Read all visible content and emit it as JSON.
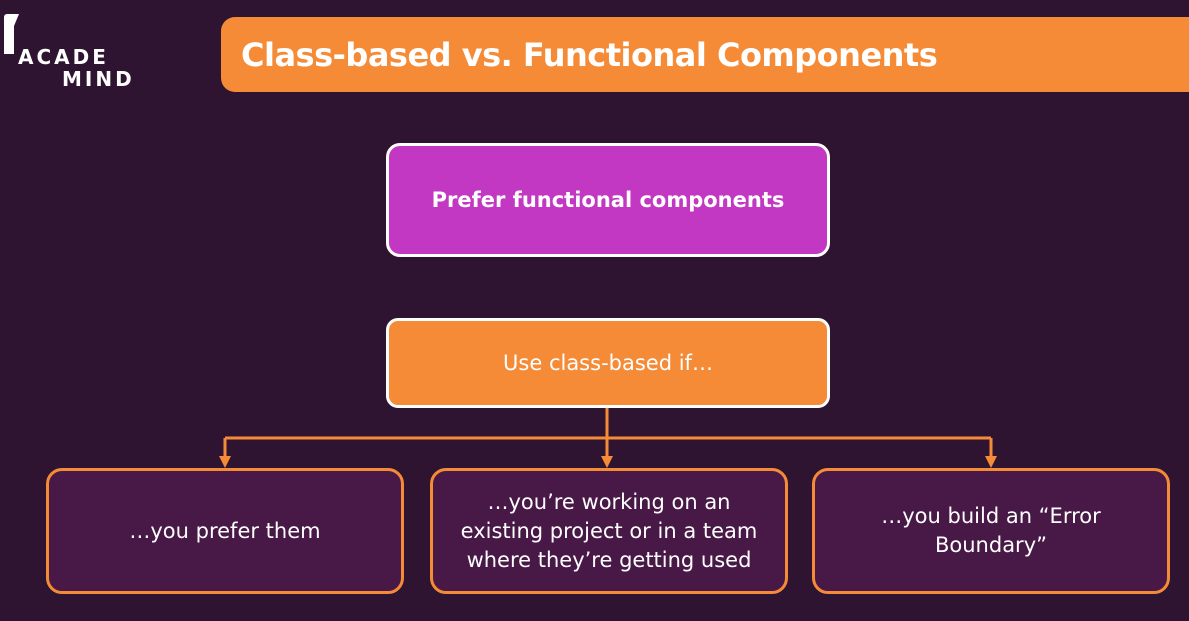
{
  "logo": {
    "line1": "ACADE",
    "line2": "MIND"
  },
  "title": "Class-based vs. Functional Components",
  "diagram": {
    "top_box": "Prefer functional components",
    "middle_box": "Use class-based if…",
    "leaves": [
      "…you prefer them",
      "…you’re working on an existing project or in a team where they’re getting used",
      "…you build an “Error Boundary”"
    ]
  },
  "colors": {
    "background": "#2f1431",
    "accent_orange": "#f58b36",
    "accent_magenta": "#c238c3",
    "leaf_fill": "#481847",
    "text": "#ffffff"
  }
}
